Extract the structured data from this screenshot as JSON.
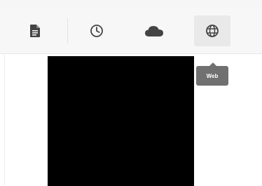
{
  "toolbar": {
    "buttons": [
      {
        "name": "file-button",
        "icon": "file-text-icon",
        "active": false
      },
      {
        "name": "history-button",
        "icon": "clock-icon",
        "active": false
      },
      {
        "name": "cloud-button",
        "icon": "cloud-icon",
        "active": false
      },
      {
        "name": "web-button",
        "icon": "globe-icon",
        "active": true
      }
    ]
  },
  "tooltip": {
    "label": "Web"
  },
  "colors": {
    "toolbar_bg": "#f7f7f7",
    "active_bg": "#e9e9e9",
    "icon": "#444444",
    "tooltip_bg": "#707070",
    "panel": "#000000"
  }
}
